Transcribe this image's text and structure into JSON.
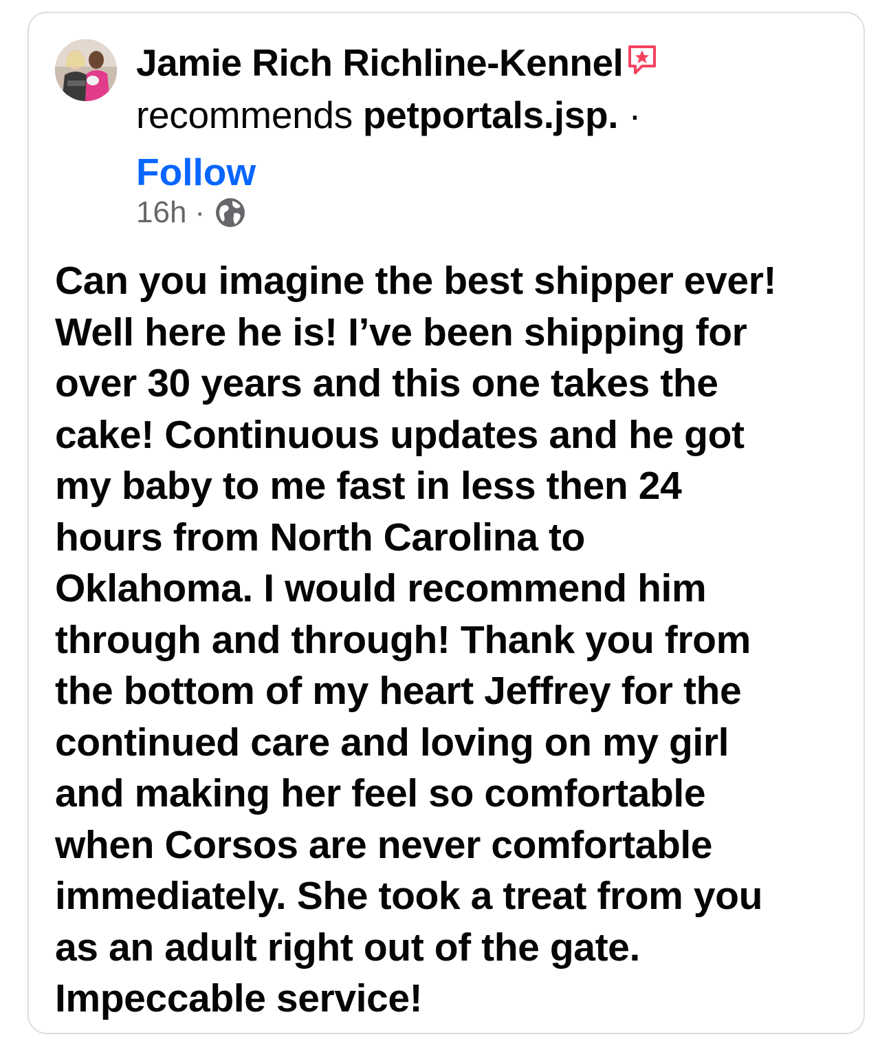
{
  "post": {
    "author_name": "Jamie Rich Richline-Kennel",
    "badge_icon": "recommendation-star-icon",
    "recommends_text": "recommends",
    "page_name": "petportals.jsp.",
    "separator": "·",
    "follow_label": "Follow",
    "timestamp": "16h",
    "meta_separator": "·",
    "privacy_icon": "globe-icon",
    "text_lines": [
      "Can you imagine the best shipper ever!",
      "Well here he is! I’ve been shipping for",
      "over 30 years and this one takes the",
      "cake! Continuous updates and he got",
      "my baby to me fast in less then 24",
      "hours from North Carolina to",
      "Oklahoma. I would recommend him",
      "through and through! Thank you from",
      "the bottom of my heart Jeffrey for the",
      "continued care and loving on my girl",
      "and making her feel so comfortable",
      "when Corsos are never comfortable",
      "immediately. She took a treat from you",
      "as an adult right out of the gate.",
      "Impeccable service!"
    ]
  },
  "colors": {
    "follow": "#0866ff",
    "meta": "#65676b",
    "badge": "#f3425f",
    "border": "#dcdde1"
  }
}
